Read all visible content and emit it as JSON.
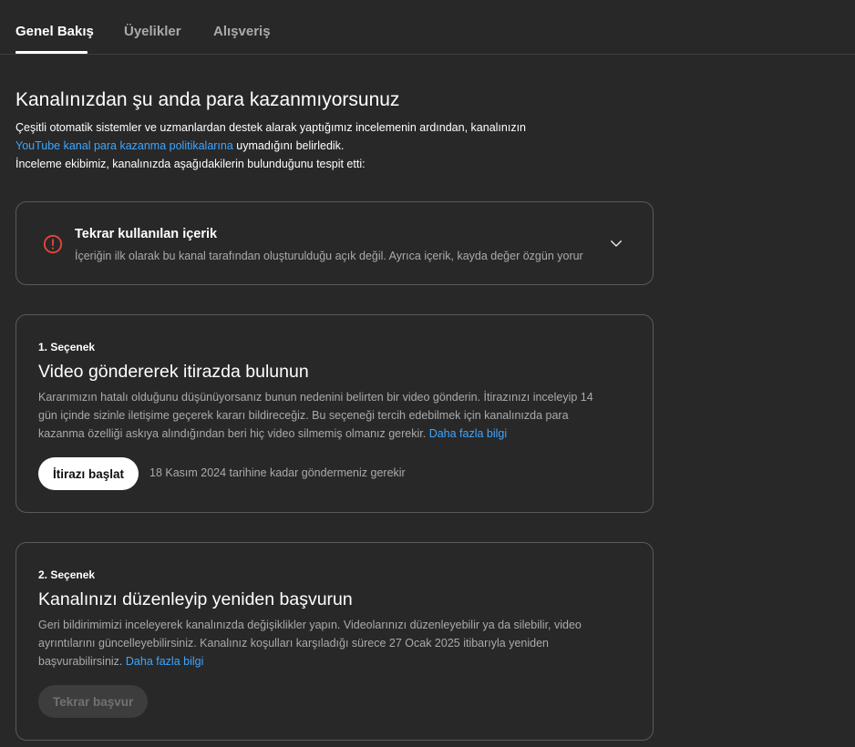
{
  "tabs": [
    {
      "label": "Genel Bakış",
      "active": true
    },
    {
      "label": "Üyelikler",
      "active": false
    },
    {
      "label": "Alışveriş",
      "active": false
    }
  ],
  "headline": "Kanalınızdan şu anda para kazanmıyorsunuz",
  "intro": {
    "line1": "Çeşitli otomatik sistemler ve uzmanlardan destek alarak yaptığımız incelemenin ardından, kanalınızın",
    "policy_link": "YouTube kanal para kazanma politikalarına",
    "line2_rest": " uymadığını belirledik.",
    "line3": "İnceleme ekibimiz, kanalınızda aşağıdakilerin bulunduğunu tespit etti:"
  },
  "issue": {
    "icon": "error-icon",
    "title": "Tekrar kullanılan içerik",
    "description": "İçeriğin ilk olarak bu kanal tarafından oluşturulduğu açık değil. Ayrıca içerik, kayda değer özgün yorur"
  },
  "option1": {
    "label": "1. Seçenek",
    "title": "Video göndererek itirazda bulunun",
    "desc_line1": "Kararımızın hatalı olduğunu düşünüyorsanız bunun nedenini belirten bir video gönderin. İtirazınızı inceleyip 14",
    "desc_line2": "gün içinde sizinle iletişime geçerek kararı bildireceğiz. Bu seçeneği tercih edebilmek için kanalınızda para",
    "desc_line3": "kazanma özelliği askıya alındığından beri hiç video silmemiş olmanız gerekir.",
    "learn_more": "Daha fazla bilgi",
    "button": "İtirazı başlat",
    "deadline": "18 Kasım 2024 tarihine kadar göndermeniz gerekir"
  },
  "option2": {
    "label": "2. Seçenek",
    "title": "Kanalınızı düzenleyip yeniden başvurun",
    "desc_line1": "Geri bildirimimizi inceleyerek kanalınızda değişiklikler yapın. Videolarınızı düzenleyebilir ya da silebilir, video",
    "desc_line2": "ayrıntılarını güncelleyebilirsiniz. Kanalınız koşulları karşıladığı sürece 27 Ocak 2025 itibarıyla yeniden",
    "desc_line3": "başvurabilirsiniz.",
    "learn_more": "Daha fazla bilgi",
    "button": "Tekrar başvur"
  },
  "colors": {
    "background": "#282828",
    "link": "#3ea6ff",
    "error": "#e8453c",
    "muted_text": "#aaaaaa",
    "card_border": "#5a5a5a"
  }
}
